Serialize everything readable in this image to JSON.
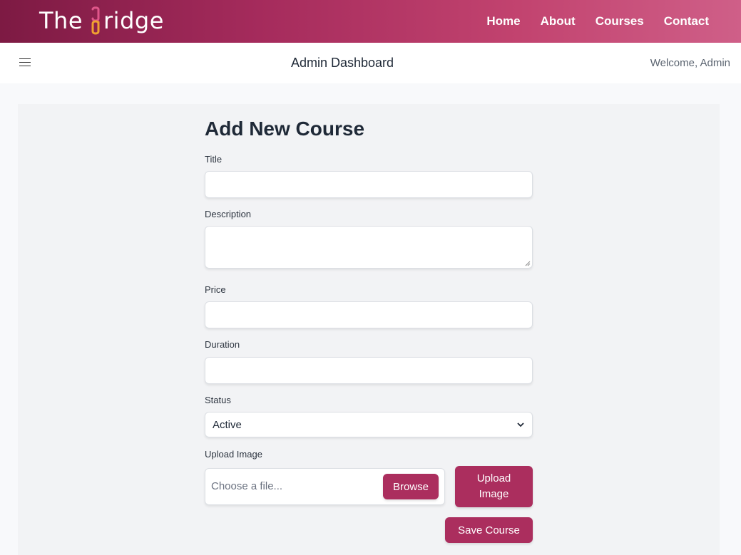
{
  "brand": {
    "text_before": "The",
    "text_after": "ridge",
    "primary_color": "#ab2e5e",
    "accent_color": "#f0a030"
  },
  "topnav": {
    "links": [
      "Home",
      "About",
      "Courses",
      "Contact"
    ]
  },
  "subheader": {
    "menu_icon": "hamburger-icon",
    "title": "Admin Dashboard",
    "welcome": "Welcome, Admin"
  },
  "form": {
    "heading": "Add New Course",
    "title_label": "Title",
    "title_value": "",
    "description_label": "Description",
    "description_value": "",
    "price_label": "Price",
    "price_value": "",
    "duration_label": "Duration",
    "duration_value": "",
    "status_label": "Status",
    "status_value": "Active",
    "upload_label": "Upload Image",
    "file_placeholder": "Choose a file...",
    "browse_label": "Browse",
    "upload_button": "Upload Image",
    "save_button": "Save Course"
  }
}
